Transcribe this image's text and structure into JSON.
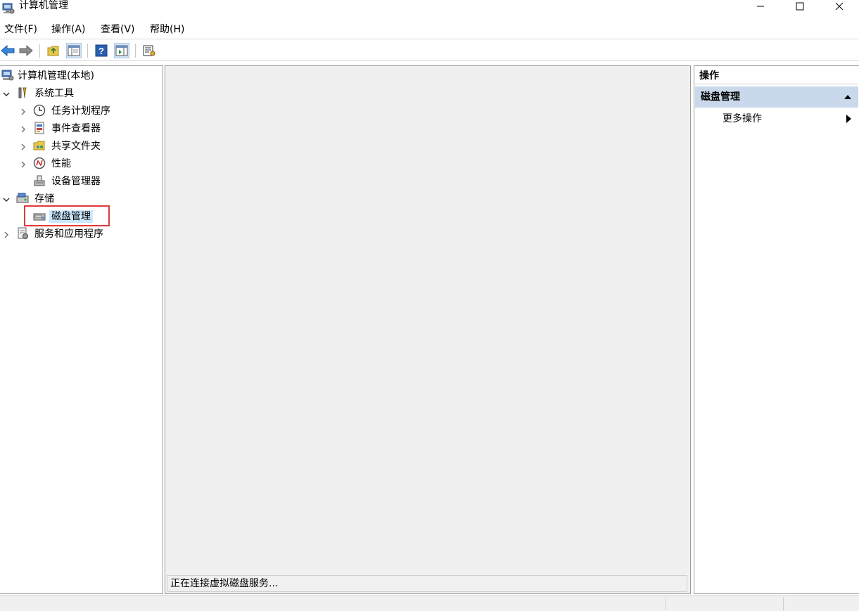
{
  "window": {
    "title": "计算机管理",
    "icon": "computer-management-icon"
  },
  "menu": {
    "items": [
      "文件(F)",
      "操作(A)",
      "查看(V)",
      "帮助(H)"
    ]
  },
  "toolbar": {
    "icons": [
      "back-arrow-icon",
      "forward-arrow-icon",
      "up-folder-icon",
      "show-hide-tree-icon",
      "help-icon",
      "show-action-pane-icon",
      "properties-icon"
    ]
  },
  "tree": {
    "root": "计算机管理(本地)",
    "system_tools": "系统工具",
    "task_scheduler": "任务计划程序",
    "event_viewer": "事件查看器",
    "shared_folders": "共享文件夹",
    "performance": "性能",
    "device_manager": "设备管理器",
    "storage": "存储",
    "disk_management": "磁盘管理",
    "services_apps": "服务和应用程序"
  },
  "center": {
    "status": "正在连接虚拟磁盘服务..."
  },
  "actions": {
    "header": "操作",
    "section": "磁盘管理",
    "more": "更多操作"
  },
  "colors": {
    "highlight_border": "#e03a3a",
    "action_section_bg": "#c9d8ea",
    "selection_bg": "#cce8ff"
  }
}
